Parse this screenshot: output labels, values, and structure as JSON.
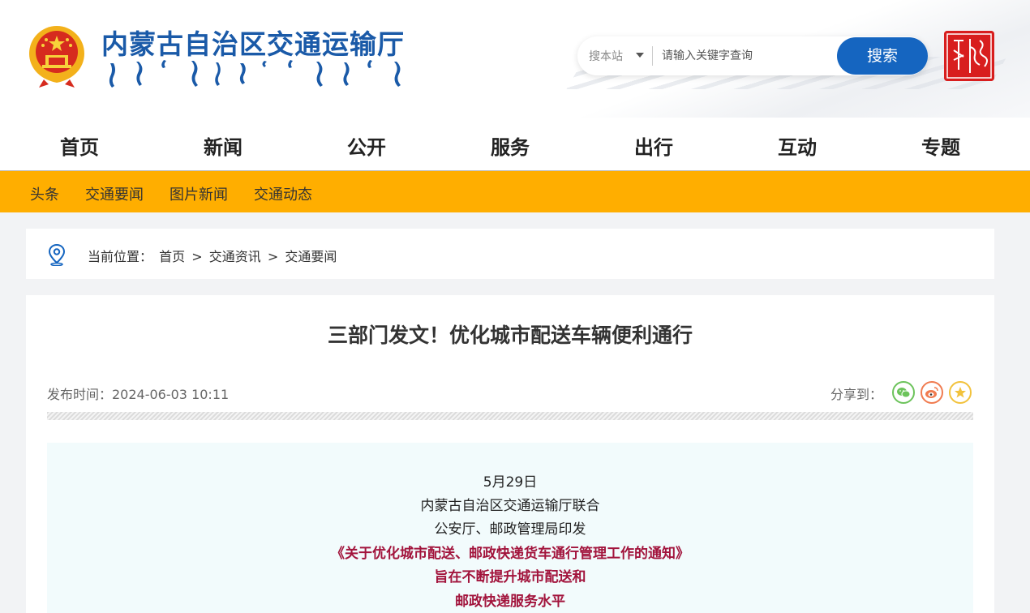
{
  "header": {
    "site_title": "内蒙古自治区交通运输厅",
    "search": {
      "scope_label": "搜本站",
      "placeholder": "请输入关键字查询",
      "button_label": "搜索"
    },
    "colors": {
      "brand_blue": "#1a5aa8",
      "search_button": "#1565c0",
      "seal_red": "#d81e1e"
    }
  },
  "main_nav": {
    "items": [
      {
        "label": "首页"
      },
      {
        "label": "新闻"
      },
      {
        "label": "公开"
      },
      {
        "label": "服务"
      },
      {
        "label": "出行"
      },
      {
        "label": "互动"
      },
      {
        "label": "专题"
      }
    ]
  },
  "sub_nav": {
    "color": "#ffae00",
    "items": [
      {
        "label": "头条"
      },
      {
        "label": "交通要闻"
      },
      {
        "label": "图片新闻"
      },
      {
        "label": "交通动态"
      }
    ]
  },
  "breadcrumb": {
    "prefix": "当前位置：",
    "items": [
      {
        "label": "首页"
      },
      {
        "label": "交通资讯"
      },
      {
        "label": "交通要闻"
      }
    ],
    "separator": ">"
  },
  "article": {
    "title": "三部门发文！优化城市配送车辆便利通行",
    "published": "发布时间：2024-06-03 10:11",
    "share_label": "分享到：",
    "share_icons": [
      "wechat-icon",
      "weibo-icon",
      "favorite-star-icon"
    ],
    "lead": [
      {
        "text": "5月29日",
        "style": "normal"
      },
      {
        "text": "内蒙古自治区交通运输厅联合",
        "style": "normal"
      },
      {
        "text": "公安厅、邮政管理局印发",
        "style": "normal"
      },
      {
        "text": "《关于优化城市配送、邮政快递货车通行管理工作的通知》",
        "style": "highlight"
      },
      {
        "text": "旨在不断提升城市配送和",
        "style": "highlight"
      },
      {
        "text": "邮政快递服务水平",
        "style": "highlight"
      }
    ]
  }
}
